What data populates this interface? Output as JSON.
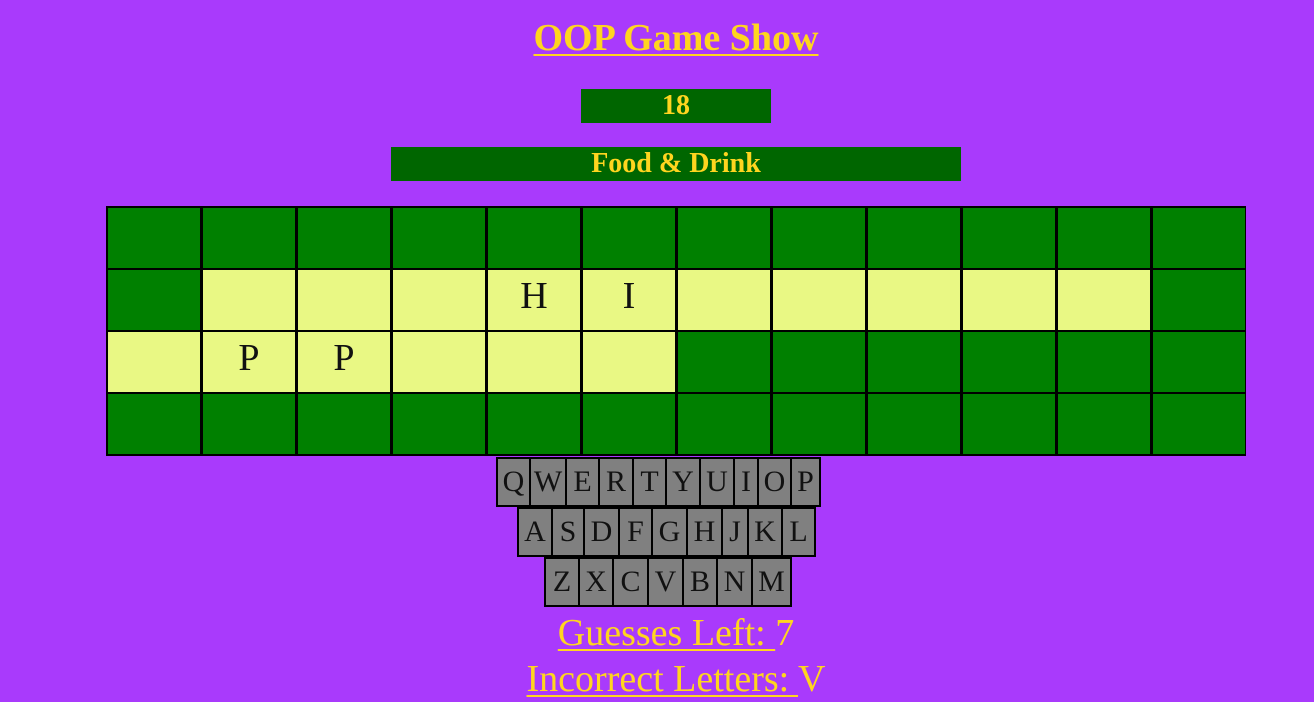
{
  "header": {
    "title": "OOP Game Show"
  },
  "score": {
    "value": "18"
  },
  "category": {
    "label": "Food & Drink"
  },
  "board": {
    "rows": [
      [
        null,
        null,
        null,
        null,
        null,
        null,
        null,
        null,
        null,
        null,
        null,
        null
      ],
      [
        null,
        "",
        "",
        "",
        "H",
        "I",
        "",
        "",
        "",
        "",
        "",
        null
      ],
      [
        "",
        "P",
        "P",
        "",
        "",
        "",
        null,
        null,
        null,
        null,
        null,
        null
      ],
      [
        null,
        null,
        null,
        null,
        null,
        null,
        null,
        null,
        null,
        null,
        null,
        null
      ]
    ]
  },
  "keyboard": {
    "rows": [
      [
        "Q",
        "W",
        "E",
        "R",
        "T",
        "Y",
        "U",
        "I",
        "O",
        "P"
      ],
      [
        "A",
        "S",
        "D",
        "F",
        "G",
        "H",
        "J",
        "K",
        "L"
      ],
      [
        "Z",
        "X",
        "C",
        "V",
        "B",
        "N",
        "M"
      ]
    ]
  },
  "status": {
    "guesses_label": "Guesses Left: ",
    "guesses_value": "7",
    "incorrect_label": "Incorrect Letters: ",
    "incorrect_value": "V"
  },
  "colors": {
    "background": "#a93afc",
    "accent_text": "#ffd51f",
    "panel": "#006600",
    "blank_tile": "#008000",
    "letter_slot": "#e9f884",
    "key": "#808080"
  }
}
